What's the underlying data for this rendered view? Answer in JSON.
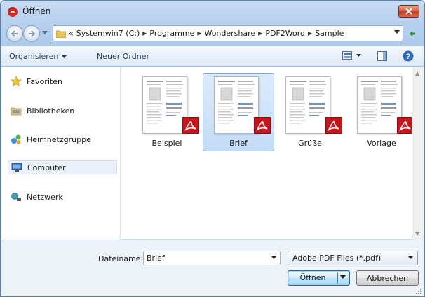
{
  "window": {
    "title": "Öffnen"
  },
  "address": {
    "crumbs": [
      "«",
      "Systemwin7 (C:)",
      "Programme",
      "Wondershare",
      "PDF2Word",
      "Sample"
    ]
  },
  "toolbar": {
    "organize_label": "Organisieren",
    "new_folder_label": "Neuer Ordner"
  },
  "sidebar": {
    "items": [
      {
        "label": "Favoriten",
        "icon": "star-icon"
      },
      {
        "label": "Bibliotheken",
        "icon": "library-icon"
      },
      {
        "label": "Heimnetzgruppe",
        "icon": "homegroup-icon"
      },
      {
        "label": "Computer",
        "icon": "computer-icon",
        "selected": true
      },
      {
        "label": "Netzwerk",
        "icon": "network-icon"
      }
    ]
  },
  "files": [
    {
      "name": "Beispiel",
      "selected": false
    },
    {
      "name": "Brief",
      "selected": true
    },
    {
      "name": "Grüße",
      "selected": false
    },
    {
      "name": "Vorlage",
      "selected": false
    }
  ],
  "bottom": {
    "filename_label": "Dateiname:",
    "filename_value": "Brief",
    "filetype": "Adobe PDF Files (*.pdf)",
    "open_label": "Öffnen",
    "cancel_label": "Abbrechen"
  },
  "colors": {
    "accent": "#2c628b",
    "selection": "#c3dcf7",
    "pdf_red": "#c4161c"
  }
}
